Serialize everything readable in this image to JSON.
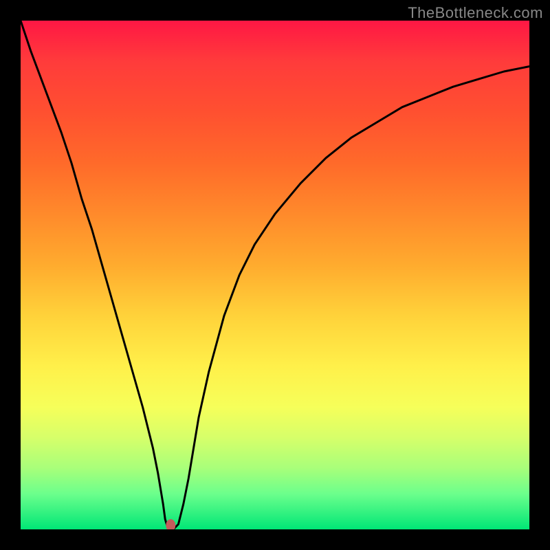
{
  "watermark": "TheBottleneck.com",
  "chart_data": {
    "type": "line",
    "title": "",
    "xlabel": "",
    "ylabel": "",
    "xlim": [
      0,
      100
    ],
    "ylim": [
      0,
      100
    ],
    "background_gradient_note": "plot background is a red→orange→yellow→green vertical gradient (high values red at top, low values green at bottom)",
    "series": [
      {
        "name": "bottleneck-curve",
        "stroke": "#000000",
        "x": [
          0,
          2,
          5,
          8,
          10,
          12,
          14,
          16,
          18,
          20,
          22,
          24,
          26,
          27,
          28,
          28.4,
          29,
          29.5,
          30,
          31,
          32,
          33,
          34,
          35,
          37,
          40,
          43,
          46,
          50,
          55,
          60,
          65,
          70,
          75,
          80,
          85,
          90,
          95,
          100
        ],
        "y": [
          100,
          94,
          86,
          78,
          72,
          65,
          59,
          52,
          45,
          38,
          31,
          24,
          16,
          11,
          5,
          2,
          0,
          0,
          0,
          1,
          5,
          10,
          16,
          22,
          31,
          42,
          50,
          56,
          62,
          68,
          73,
          77,
          80,
          83,
          85,
          87,
          88.5,
          90,
          91
        ]
      }
    ],
    "annotations": [
      {
        "name": "minimum-marker",
        "shape": "ellipse",
        "x": 29.5,
        "y": 0.8,
        "color": "#c35b5b"
      }
    ]
  }
}
